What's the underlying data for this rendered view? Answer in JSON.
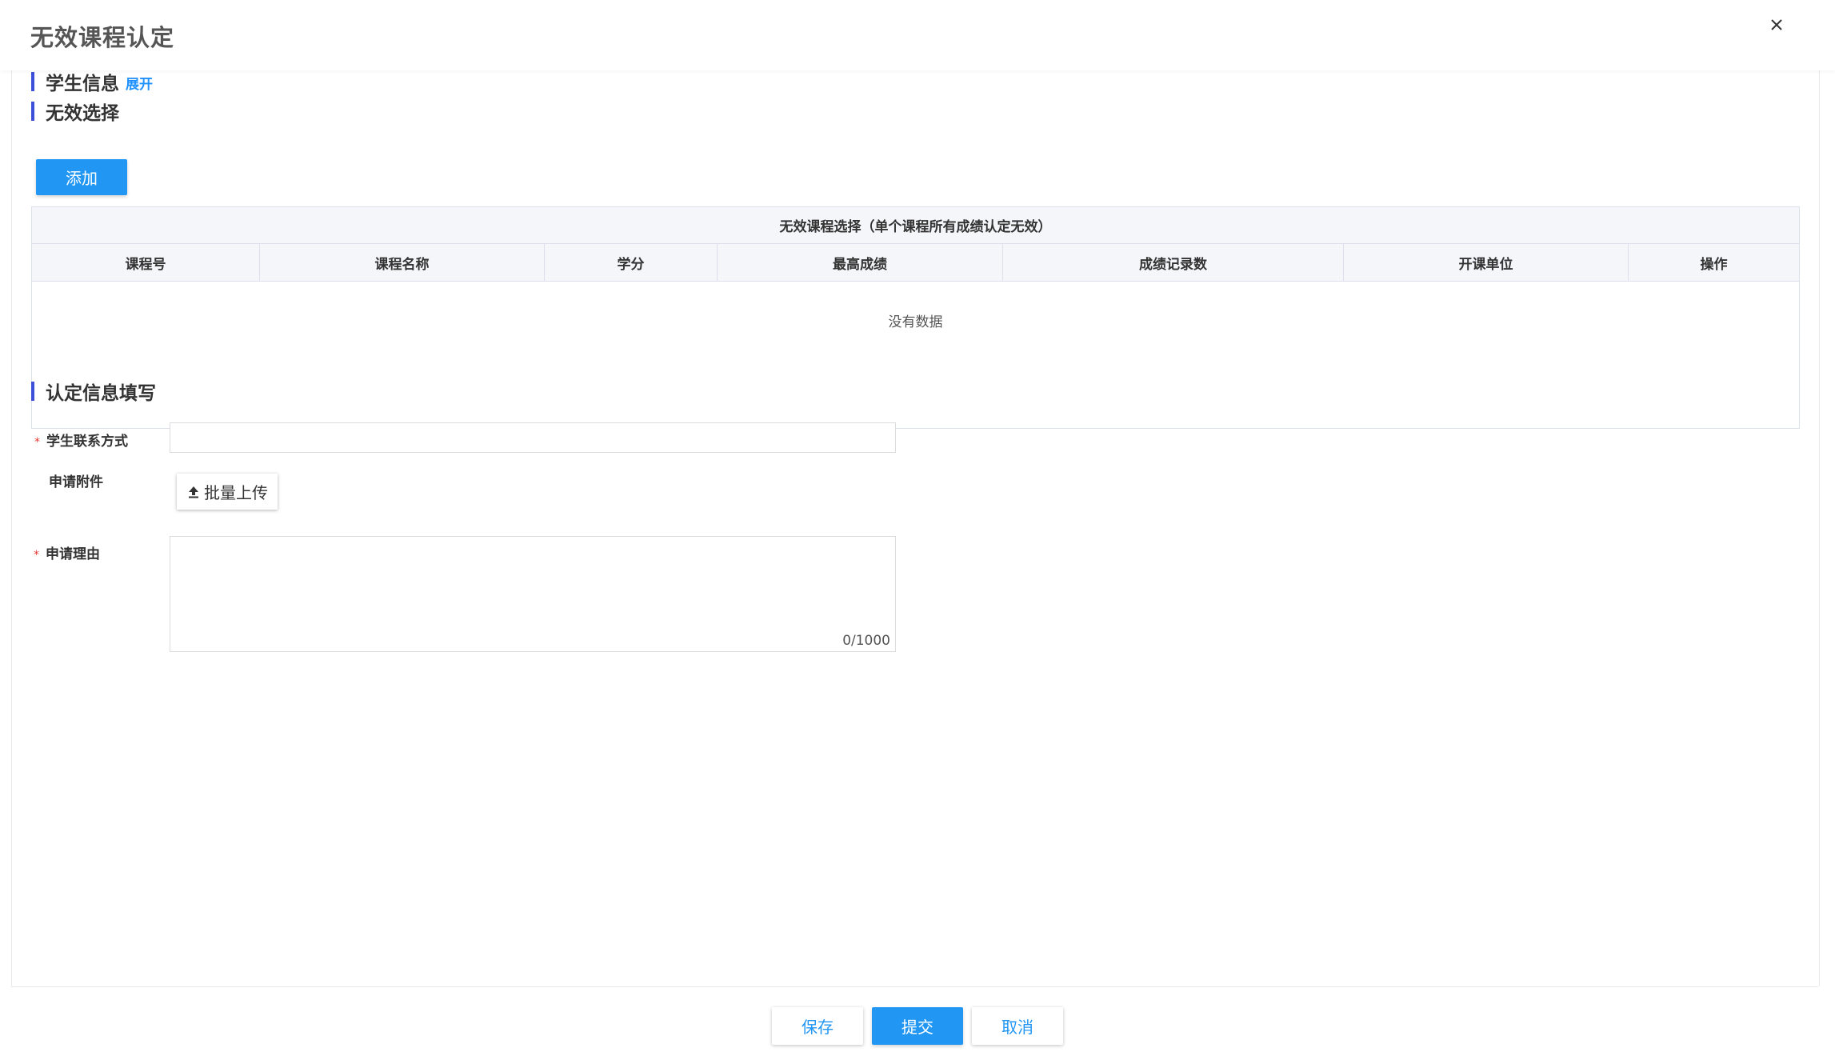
{
  "dialog": {
    "title": "无效课程认定",
    "close_icon": "close-icon"
  },
  "sections": {
    "student_info": {
      "title": "学生信息",
      "expand_label": "展开"
    },
    "invalid_selection": {
      "title": "无效选择"
    },
    "certification_info": {
      "title": "认定信息填写"
    }
  },
  "toolbar": {
    "add_label": "添加"
  },
  "grid": {
    "caption": "无效课程选择（单个课程所有成绩认定无效）",
    "columns": [
      "课程号",
      "课程名称",
      "学分",
      "最高成绩",
      "成绩记录数",
      "开课单位",
      "操作"
    ],
    "rows": [],
    "empty_text": "没有数据"
  },
  "form": {
    "contact": {
      "label": "学生联系方式",
      "required_mark": "*",
      "value": ""
    },
    "attachment": {
      "label": "申请附件",
      "upload_label": "批量上传",
      "upload_icon": "upload-icon"
    },
    "reason": {
      "label": "申请理由",
      "required_mark": "*",
      "value": "",
      "counter": "0/1000"
    }
  },
  "footer": {
    "save_label": "保存",
    "submit_label": "提交",
    "cancel_label": "取消"
  },
  "colors": {
    "accent": "#2196f3",
    "section_bar": "#3b4fd8",
    "required": "#e53935",
    "grid_header_bg": "#f5f6fa"
  }
}
